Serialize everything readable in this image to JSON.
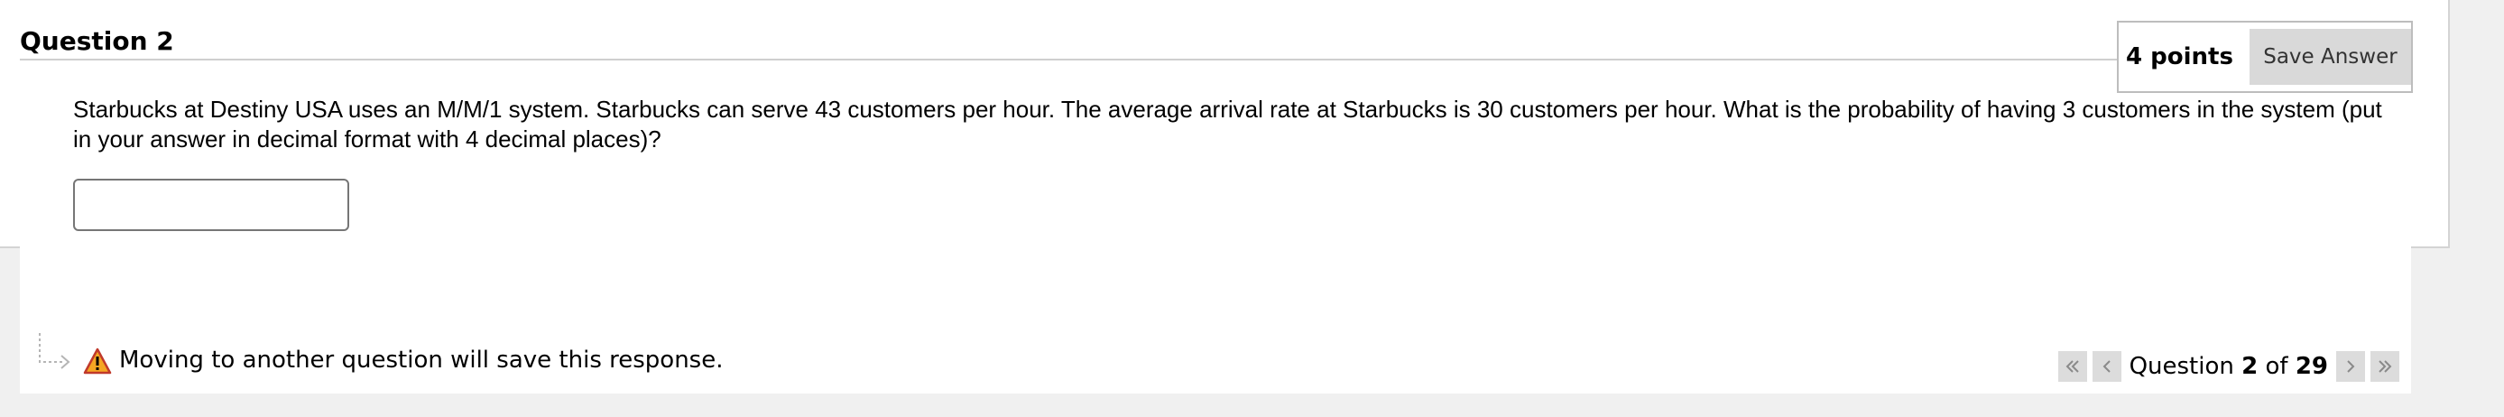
{
  "question": {
    "title": "Question 2",
    "points": "4 points",
    "save_label": "Save Answer",
    "prompt": "Starbucks at Destiny USA uses an M/M/1 system. Starbucks can serve 43 customers per hour. The average arrival rate at Starbucks is 30 customers per hour. What is the probability of having 3 customers in the system (put in your answer in decimal format with 4 decimal places)?",
    "answer_value": ""
  },
  "footer": {
    "warning": "Moving to another question will save this response.",
    "nav_prefix": "Question ",
    "current": "2",
    "of_label": " of ",
    "total": "29"
  },
  "icons": {
    "warning": "warning-triangle-icon",
    "first": "double-chevron-left-icon",
    "prev": "chevron-left-icon",
    "next": "chevron-right-icon",
    "last": "double-chevron-right-icon"
  },
  "colors": {
    "warning_fill": "#f5a623",
    "warning_border": "#c0392b",
    "button_bg": "#d9d9d9"
  }
}
